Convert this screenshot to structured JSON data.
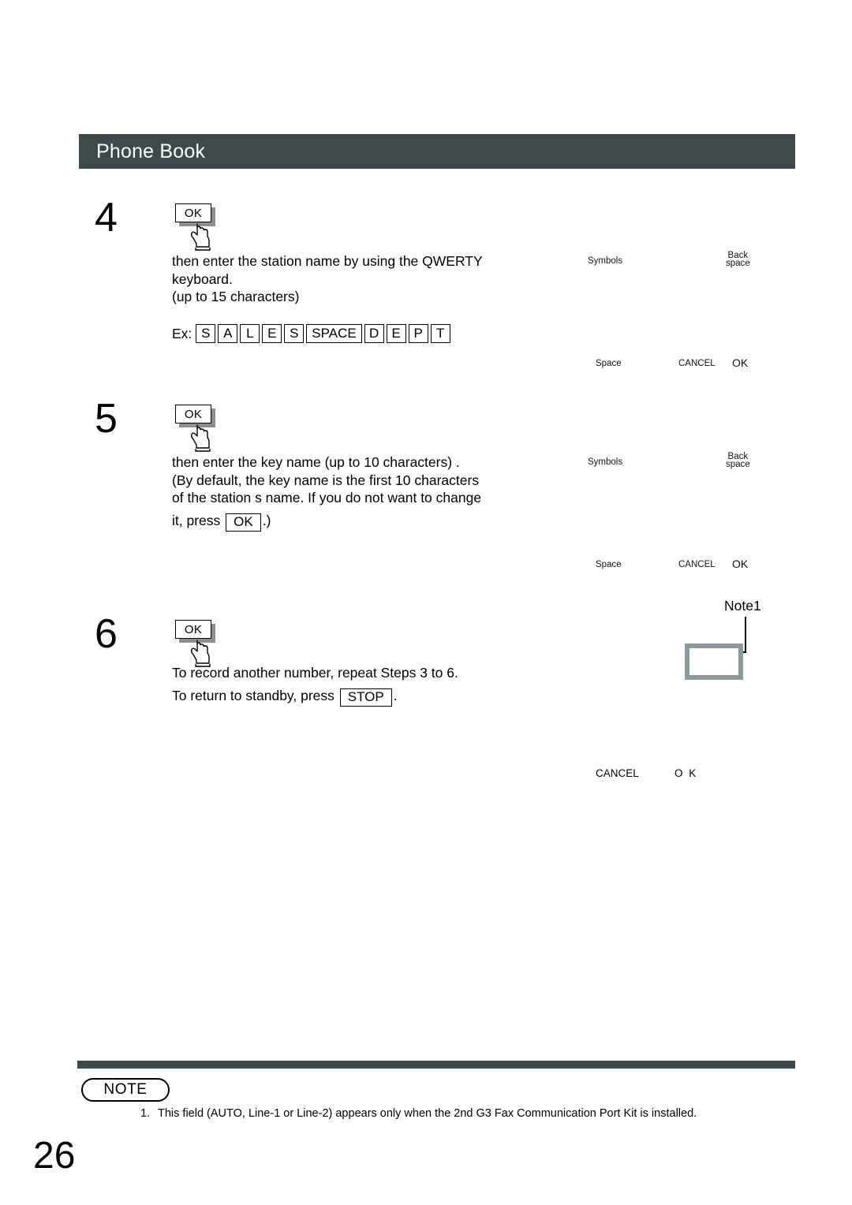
{
  "header": {
    "title": "Phone Book",
    "bar_color": "#3e4a4a"
  },
  "steps": [
    {
      "number": "4",
      "key_label": "OK",
      "lines": [
        "then enter the station name by using the QWERTY",
        "keyboard.",
        "(up to 15 characters)"
      ],
      "example": {
        "label": "Ex:",
        "keys": [
          "S",
          "A",
          "L",
          "E",
          "S",
          "SPACE",
          "D",
          "E",
          "P",
          "T"
        ]
      }
    },
    {
      "number": "5",
      "key_label": "OK",
      "lines": [
        "then enter the key name (up to 10 characters) .",
        " (By default, the key name is the first 10 characters",
        "of the station s name.  If you do not want to change"
      ],
      "last_line_prefix": "it, press ",
      "last_line_key": "OK",
      "last_line_suffix": ".)"
    },
    {
      "number": "6",
      "key_label": "OK",
      "lines": [
        "To record another number, repeat Steps 3 to 6."
      ],
      "standby_prefix": "To return to standby, press ",
      "standby_key": "STOP",
      "standby_suffix": "."
    }
  ],
  "lcd_panels": [
    {
      "symbols": "Symbols",
      "backspace_line1": "Back",
      "backspace_line2": "space",
      "space": "Space",
      "cancel": "CANCEL",
      "ok": "OK"
    },
    {
      "symbols": "Symbols",
      "backspace_line1": "Back",
      "backspace_line2": "space",
      "space": "Space",
      "cancel": "CANCEL",
      "ok": "OK"
    }
  ],
  "note_callout": {
    "label": "Note1",
    "border_color": "#8a9a9a"
  },
  "lcd_bottom_row": {
    "cancel": "CANCEL",
    "ok": "O K"
  },
  "footer": {
    "note_badge": "NOTE",
    "notes": [
      {
        "number": "1.",
        "text": "This field (AUTO, Line-1 or Line-2) appears only when the 2nd G3 Fax Communication Port Kit is installed."
      }
    ],
    "page_number": "26"
  }
}
